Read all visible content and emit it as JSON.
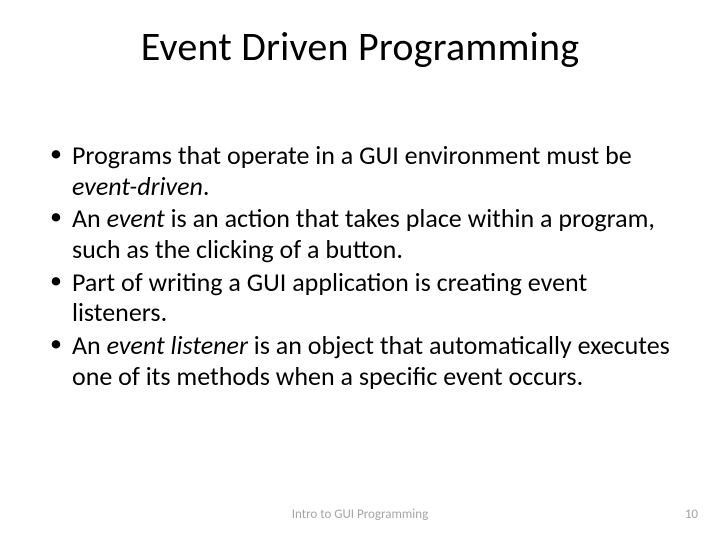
{
  "slide": {
    "title": "Event Driven Programming",
    "bullets": [
      {
        "pre": "Programs that operate in a GUI environment must be ",
        "em": "event-driven",
        "post": "."
      },
      {
        "pre": "An ",
        "em": "event",
        "post": " is an action that takes place within a program, such as the clicking of a button."
      },
      {
        "pre": "Part of writing a GUI application is creating event listeners.",
        "em": "",
        "post": ""
      },
      {
        "pre": "An ",
        "em": "event listener",
        "post": " is an object that automatically executes one of its methods when a specific event occurs."
      }
    ],
    "footer_center": "Intro to GUI Programming",
    "page_number": "10"
  }
}
